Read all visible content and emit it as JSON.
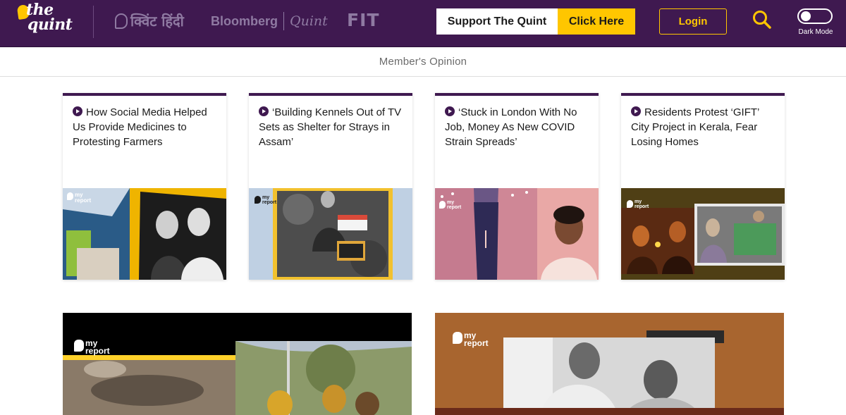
{
  "header": {
    "logo_line1": "the",
    "logo_line2": "quint",
    "partners": {
      "hindi": "क्विंट हिंदी",
      "bloomberg": "Bloomberg",
      "quint": "Quint",
      "fit": "FIT"
    },
    "support_label": "Support The Quint",
    "click_label": "Click Here",
    "login_label": "Login",
    "dark_mode_label": "Dark Mode",
    "search_icon": "search-icon"
  },
  "section": {
    "title": "Member's Opinion"
  },
  "cards": [
    {
      "title": "How Social Media Helped Us Provide Medicines to Protesting Farmers",
      "badge_line1": "my",
      "badge_line2": "report",
      "icon": "play-icon"
    },
    {
      "title": "‘Building Kennels Out of TV Sets as Shelter for Strays in Assam’",
      "badge_line1": "my",
      "badge_line2": "report",
      "icon": "play-icon"
    },
    {
      "title": "‘Stuck in London With No Job, Money As New COVID Strain Spreads’",
      "badge_line1": "my",
      "badge_line2": "report",
      "icon": "play-icon"
    },
    {
      "title": "Residents Protest ‘GIFT’ City Project in Kerala, Fear Losing Homes",
      "badge_line1": "my",
      "badge_line2": "report",
      "icon": "play-icon"
    }
  ],
  "featured": [
    {
      "badge_line1": "my",
      "badge_line2": "report"
    },
    {
      "badge_line1": "my",
      "badge_line2": "report"
    }
  ],
  "colors": {
    "brand_purple": "#3f1950",
    "brand_yellow": "#ffc600"
  }
}
